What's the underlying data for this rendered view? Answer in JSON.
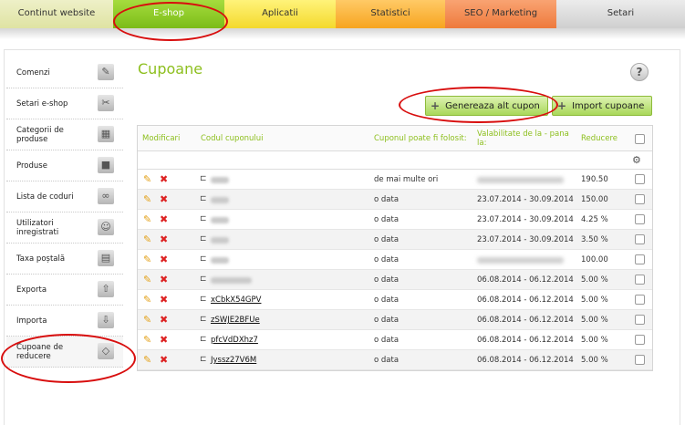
{
  "nav": {
    "tabs": [
      "Continut website",
      "E-shop",
      "Aplicatii",
      "Statistici",
      "SEO / Marketing",
      "Setari"
    ],
    "active": "E-shop"
  },
  "sidebar": {
    "items": [
      {
        "label": "Comenzi",
        "icon": "clipboard-icon"
      },
      {
        "label": "Setari e-shop",
        "icon": "tools-icon"
      },
      {
        "label": "Categorii de produse",
        "icon": "boxes-icon"
      },
      {
        "label": "Produse",
        "icon": "box-icon"
      },
      {
        "label": "Lista de coduri",
        "icon": "binoculars-icon"
      },
      {
        "label": "Utilizatori inregistrati",
        "icon": "users-icon"
      },
      {
        "label": "Taxa poștală",
        "icon": "truck-icon"
      },
      {
        "label": "Exporta",
        "icon": "export-icon"
      },
      {
        "label": "Importa",
        "icon": "import-icon"
      },
      {
        "label": "Cupoane de reducere",
        "icon": "tag-icon"
      }
    ]
  },
  "page": {
    "title": "Cupoane",
    "help": "?"
  },
  "buttons": {
    "generate": "Genereaza alt cupon",
    "import": "Import cupoane"
  },
  "table": {
    "headers": {
      "edit": "Modificari",
      "code": "Codul cuponului",
      "usage": "Cuponul poate fi folosit:",
      "validity": "Valabilitate de la - pana la:",
      "discount": "Reducere"
    },
    "rows": [
      {
        "code": "",
        "usage": "de mai multe ori",
        "validity": "",
        "discount": "190.50"
      },
      {
        "code": "",
        "usage": "o data",
        "validity": "23.07.2014 - 30.09.2014",
        "discount": "150.00"
      },
      {
        "code": "",
        "usage": "o data",
        "validity": "23.07.2014 - 30.09.2014",
        "discount": "4.25 %"
      },
      {
        "code": "",
        "usage": "o data",
        "validity": "23.07.2014 - 30.09.2014",
        "discount": "3.50 %"
      },
      {
        "code": "",
        "usage": "o data",
        "validity": "",
        "discount": "100.00"
      },
      {
        "code": "",
        "usage": "o data",
        "validity": "06.08.2014 - 06.12.2014",
        "discount": "5.00 %"
      },
      {
        "code": "xCbkX54GPV",
        "usage": "o data",
        "validity": "06.08.2014 - 06.12.2014",
        "discount": "5.00 %"
      },
      {
        "code": "zSWJE2BFUe",
        "usage": "o data",
        "validity": "06.08.2014 - 06.12.2014",
        "discount": "5.00 %"
      },
      {
        "code": "pfcVdDXhz7",
        "usage": "o data",
        "validity": "06.08.2014 - 06.12.2014",
        "discount": "5.00 %"
      },
      {
        "code": "Jyssz27V6M",
        "usage": "o data",
        "validity": "06.08.2014 - 06.12.2014",
        "discount": "5.00 %"
      }
    ]
  },
  "colors": {
    "accent": "#8dbf1e",
    "annotation": "#d80e0e"
  }
}
